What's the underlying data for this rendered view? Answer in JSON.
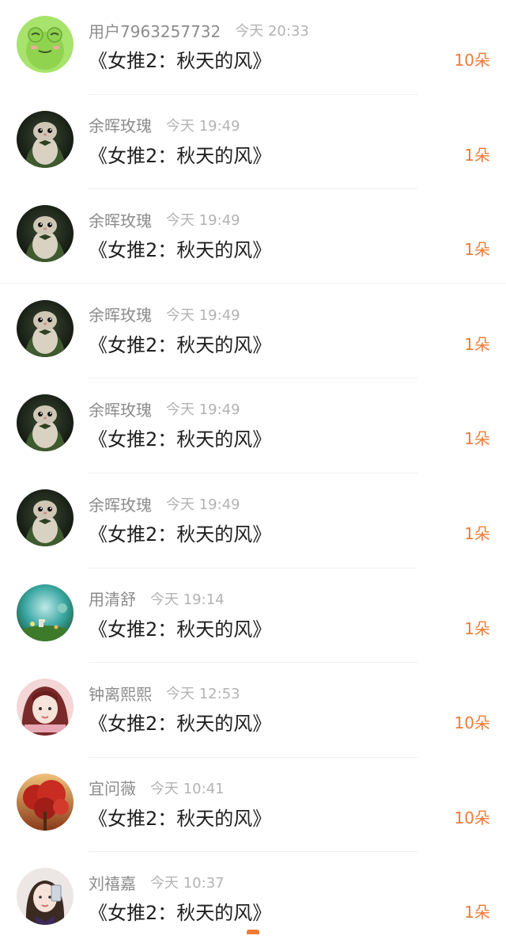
{
  "colors": {
    "accent": "#ef7b35",
    "username": "#8c8c8c",
    "time": "#b3b3b3",
    "title": "#1f1f1f"
  },
  "rows": [
    {
      "user": "用户7963257732",
      "time": "今天 20:33",
      "title": "《女推2：秋天的风》",
      "count": "10朵",
      "avatar": "frog-avatar"
    },
    {
      "user": "余晖玫瑰",
      "time": "今天 19:49",
      "title": "《女推2：秋天的风》",
      "count": "1朵",
      "avatar": "hamster-avatar"
    },
    {
      "user": "余晖玫瑰",
      "time": "今天 19:49",
      "title": "《女推2：秋天的风》",
      "count": "1朵",
      "avatar": "hamster-avatar"
    },
    {
      "user": "余晖玫瑰",
      "time": "今天 19:49",
      "title": "《女推2：秋天的风》",
      "count": "1朵",
      "avatar": "hamster-avatar"
    },
    {
      "user": "余晖玫瑰",
      "time": "今天 19:49",
      "title": "《女推2：秋天的风》",
      "count": "1朵",
      "avatar": "hamster-avatar"
    },
    {
      "user": "余晖玫瑰",
      "time": "今天 19:49",
      "title": "《女推2：秋天的风》",
      "count": "1朵",
      "avatar": "hamster-avatar"
    },
    {
      "user": "用清舒",
      "time": "今天 19:14",
      "title": "《女推2：秋天的风》",
      "count": "1朵",
      "avatar": "scenery-avatar"
    },
    {
      "user": "钟离熙熙",
      "time": "今天 12:53",
      "title": "《女推2：秋天的风》",
      "count": "10朵",
      "avatar": "girl-avatar"
    },
    {
      "user": "宜问薇",
      "time": "今天 10:41",
      "title": "《女推2：秋天的风》",
      "count": "10朵",
      "avatar": "autumn-tree-avatar"
    },
    {
      "user": "刘禧嘉",
      "time": "今天 10:37",
      "title": "《女推2：秋天的风》",
      "count": "1朵",
      "avatar": "selfie-avatar"
    }
  ]
}
